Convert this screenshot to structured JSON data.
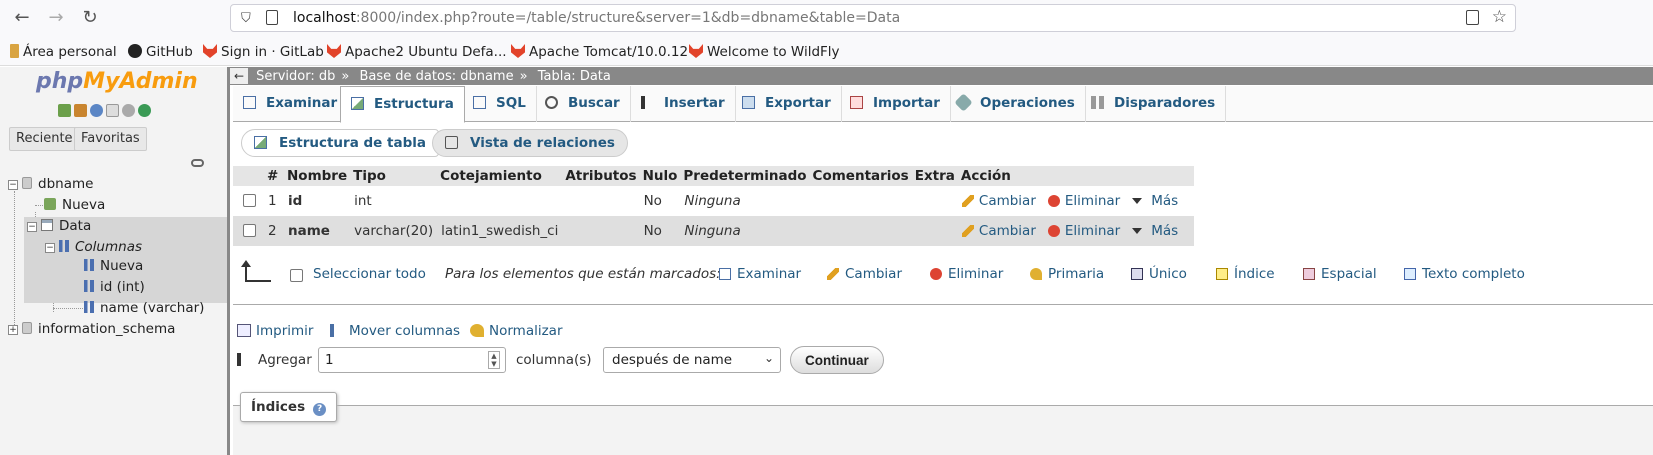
{
  "browser": {
    "url_host": "localhost",
    "url_rest": ":8000/index.php?route=/table/structure&server=1&db=dbname&table=Data",
    "bookmarks": [
      "Área personal",
      "GitHub",
      "Sign in · GitLab",
      "Apache2 Ubuntu Defa...",
      "Apache Tomcat/10.0.12",
      "Welcome to WildFly"
    ]
  },
  "leftnav": {
    "logo": {
      "php": "php",
      "my": "My",
      "admin": "Admin"
    },
    "tabs": [
      "Reciente",
      "Favoritas"
    ],
    "tree": {
      "db1": "dbname",
      "new_table": "Nueva",
      "table": "Data",
      "columns_label": "Columnas",
      "new_column": "Nueva",
      "col1": "id (int)",
      "col2": "name (varchar)",
      "db2": "information_schema"
    }
  },
  "breadcrumb": {
    "server": "Servidor: db",
    "database": "Base de datos: dbname",
    "table": "Tabla: Data",
    "separator": "»"
  },
  "tabs": [
    "Examinar",
    "Estructura",
    "SQL",
    "Buscar",
    "Insertar",
    "Exportar",
    "Importar",
    "Operaciones",
    "Disparadores"
  ],
  "active_tab": "Estructura",
  "subtabs": [
    "Estructura de tabla",
    "Vista de relaciones"
  ],
  "table": {
    "headers": [
      "",
      "#",
      "Nombre",
      "Tipo",
      "Cotejamiento",
      "Atributos",
      "Nulo",
      "Predeterminado",
      "Comentarios",
      "Extra",
      "Acción"
    ],
    "rows": [
      {
        "num": "1",
        "name": "id",
        "type": "int",
        "collation": "",
        "attributes": "",
        "null": "No",
        "default": "Ninguna",
        "comments": "",
        "extra": ""
      },
      {
        "num": "2",
        "name": "name",
        "type": "varchar(20)",
        "collation": "latin1_swedish_ci",
        "attributes": "",
        "null": "No",
        "default": "Ninguna",
        "comments": "",
        "extra": ""
      }
    ],
    "actions": {
      "change": "Cambiar",
      "drop": "Eliminar",
      "more": "Más"
    }
  },
  "selection": {
    "select_all": "Seleccionar todo",
    "note": "Para los elementos que están marcados:",
    "actions": [
      "Examinar",
      "Cambiar",
      "Eliminar",
      "Primaria",
      "Único",
      "Índice",
      "Espacial",
      "Texto completo"
    ]
  },
  "bottom_links": [
    "Imprimir",
    "Mover columnas",
    "Normalizar"
  ],
  "add_column": {
    "label": "Agregar",
    "value": "1",
    "unit": "columna(s)",
    "position": "después de name",
    "submit": "Continuar"
  },
  "indexes": {
    "title": "Índices",
    "help": "?"
  }
}
